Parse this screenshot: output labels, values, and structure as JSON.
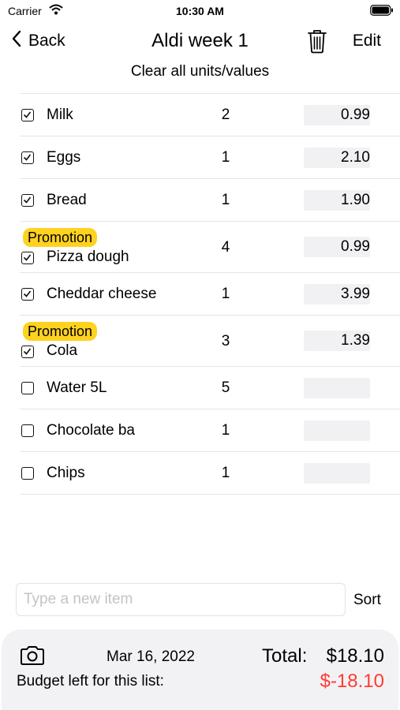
{
  "status_bar": {
    "carrier": "Carrier",
    "time": "10:30 AM"
  },
  "nav": {
    "back_label": "Back",
    "title": "Aldi week 1",
    "edit_label": "Edit"
  },
  "clear_label": "Clear all units/values",
  "items": [
    {
      "name": "Milk",
      "qty": "2",
      "price": "0.99",
      "checked": true,
      "promotion": false
    },
    {
      "name": "Eggs",
      "qty": "1",
      "price": "2.10",
      "checked": true,
      "promotion": false
    },
    {
      "name": "Bread",
      "qty": "1",
      "price": "1.90",
      "checked": true,
      "promotion": false
    },
    {
      "name": "Pizza dough",
      "qty": "4",
      "price": "0.99",
      "checked": true,
      "promotion": true
    },
    {
      "name": "Cheddar cheese",
      "qty": "1",
      "price": "3.99",
      "checked": true,
      "promotion": false
    },
    {
      "name": "Cola",
      "qty": "3",
      "price": "1.39",
      "checked": true,
      "promotion": true
    },
    {
      "name": "Water 5L",
      "qty": "5",
      "price": "",
      "checked": false,
      "promotion": false
    },
    {
      "name": "Chocolate ba",
      "qty": "1",
      "price": "",
      "checked": false,
      "promotion": false
    },
    {
      "name": "Chips",
      "qty": "1",
      "price": "",
      "checked": false,
      "promotion": false
    }
  ],
  "promotion_label": "Promotion",
  "new_item": {
    "placeholder": "Type a new item",
    "value": ""
  },
  "sort_label": "Sort",
  "footer": {
    "date": "Mar 16, 2022",
    "total_label": "Total:",
    "total_value": "$18.10",
    "budget_label": "Budget left for this list:",
    "budget_value": "$-18.10"
  },
  "colors": {
    "promotion_badge": "#ffd21f",
    "negative": "#ff3b30",
    "footer_bg": "#f2f2f5"
  },
  "icons": [
    "wifi-icon",
    "battery-icon",
    "chevron-left-icon",
    "trash-icon",
    "checkbox-icon",
    "camera-icon"
  ]
}
